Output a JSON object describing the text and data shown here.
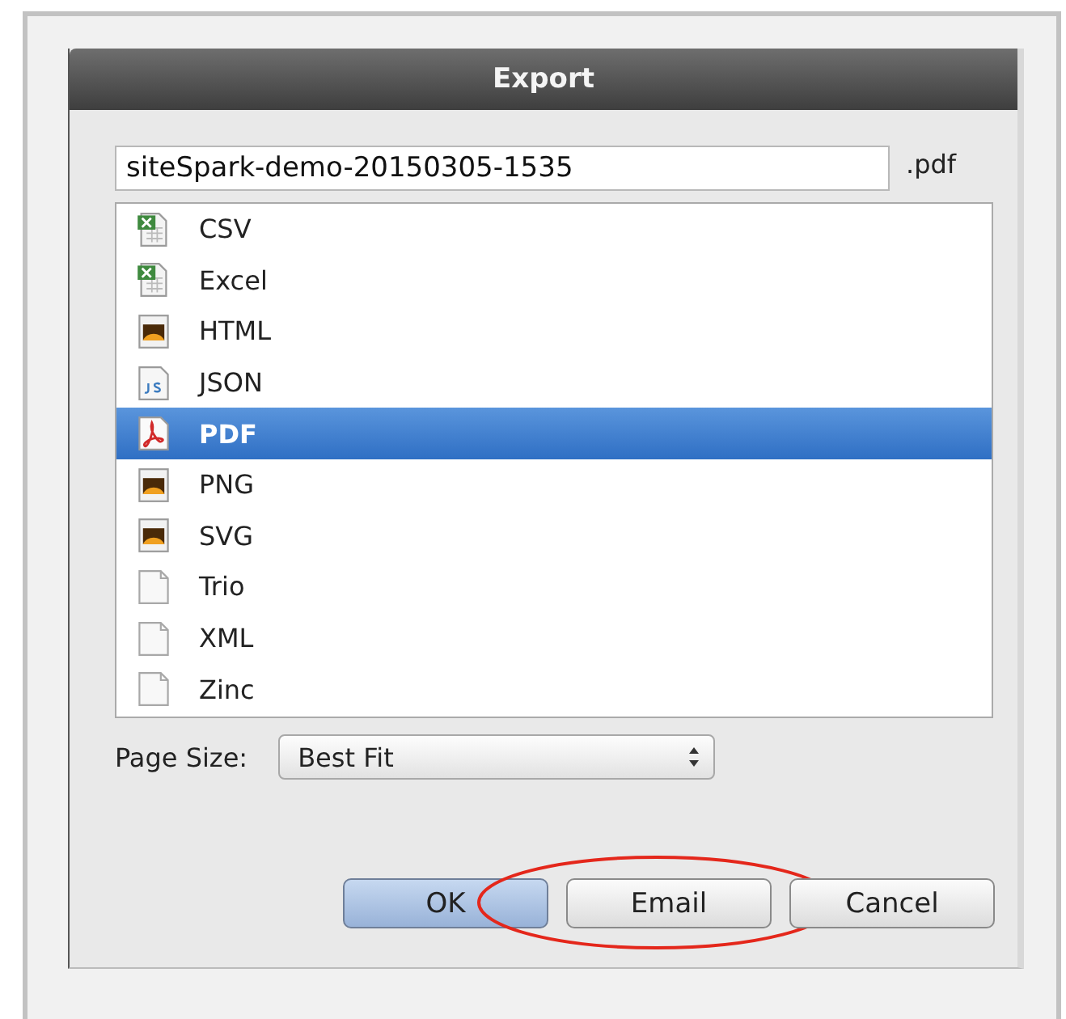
{
  "window": {
    "title": "Export"
  },
  "filename": {
    "value": "siteSpark-demo-20150305-1535",
    "extension": ".pdf"
  },
  "formats": [
    {
      "label": "CSV",
      "kind": "spreadsheet",
      "selected": false
    },
    {
      "label": "Excel",
      "kind": "spreadsheet",
      "selected": false
    },
    {
      "label": "HTML",
      "kind": "image",
      "selected": false
    },
    {
      "label": "JSON",
      "kind": "script",
      "selected": false
    },
    {
      "label": "PDF",
      "kind": "pdf",
      "selected": true
    },
    {
      "label": "PNG",
      "kind": "image",
      "selected": false
    },
    {
      "label": "SVG",
      "kind": "image",
      "selected": false
    },
    {
      "label": "Trio",
      "kind": "blank",
      "selected": false
    },
    {
      "label": "XML",
      "kind": "blank",
      "selected": false
    },
    {
      "label": "Zinc",
      "kind": "blank",
      "selected": false
    }
  ],
  "page_size": {
    "label": "Page Size:",
    "value": "Best Fit"
  },
  "buttons": [
    {
      "label": "OK",
      "default": true,
      "highlighted": false
    },
    {
      "label": "Email",
      "default": false,
      "highlighted": true
    },
    {
      "label": "Cancel",
      "default": false,
      "highlighted": false
    }
  ]
}
